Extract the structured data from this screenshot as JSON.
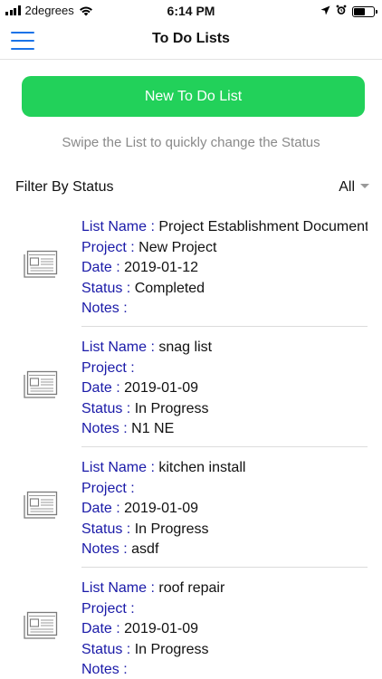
{
  "status_bar": {
    "carrier": "2degrees",
    "time": "6:14 PM",
    "battery_fill": 0.55
  },
  "nav": {
    "title": "To Do Lists"
  },
  "new_button_label": "New To Do List",
  "hint": "Swipe the List to quickly change the Status",
  "filter": {
    "label": "Filter By Status",
    "selected": "All"
  },
  "field_labels": {
    "list_name": "List Name :",
    "project": "Project :",
    "date": "Date :",
    "status": "Status :",
    "notes": "Notes :"
  },
  "items": [
    {
      "list_name": "Project Establishment Documents",
      "project": "New Project",
      "date": "2019-01-12",
      "status": "Completed",
      "notes": ""
    },
    {
      "list_name": "snag list",
      "project": "",
      "date": "2019-01-09",
      "status": "In Progress",
      "notes": "N1 NE"
    },
    {
      "list_name": "kitchen install",
      "project": "",
      "date": "2019-01-09",
      "status": "In Progress",
      "notes": "asdf"
    },
    {
      "list_name": "roof repair",
      "project": "",
      "date": "2019-01-09",
      "status": "In Progress",
      "notes": ""
    }
  ],
  "colors": {
    "accent": "#1a73e8",
    "button": "#22d15a",
    "label": "#1a1aa8"
  },
  "icons": {
    "menu": "hamburger-menu-icon",
    "item": "newspaper-icon"
  }
}
